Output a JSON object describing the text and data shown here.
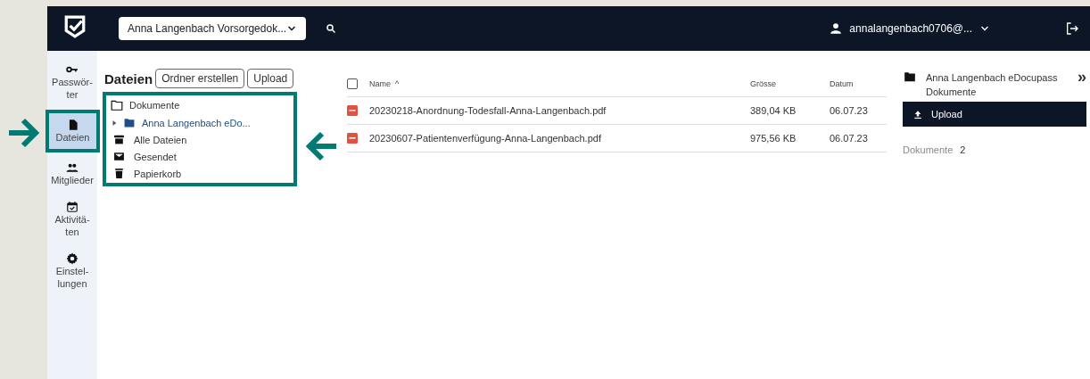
{
  "topbar": {
    "workspace": "Anna Langenbach Vorsorgedok...",
    "user": "annalangenbach0706@..."
  },
  "sidebar": {
    "items": [
      {
        "kind": "key",
        "lines": [
          "Passwör-",
          "ter"
        ],
        "selected": false
      },
      {
        "kind": "file",
        "lines": [
          "Dateien"
        ],
        "selected": true
      },
      {
        "kind": "users",
        "lines": [
          "Mitglieder"
        ],
        "selected": false
      },
      {
        "kind": "calendar",
        "lines": [
          "Aktivitä-",
          "ten"
        ],
        "selected": false
      },
      {
        "kind": "gear",
        "lines": [
          "Einstel-",
          "lungen"
        ],
        "selected": false
      }
    ]
  },
  "files_panel": {
    "title": "Dateien",
    "buttons": [
      "Ordner erstellen",
      "Upload"
    ],
    "tree": {
      "label": "Dokumente",
      "children": [
        {
          "label": "Anna Langenbach eDo...",
          "expanded": false
        }
      ]
    },
    "links": [
      {
        "kind": "archive",
        "label": "Alle Dateien"
      },
      {
        "kind": "mail",
        "label": "Gesendet"
      },
      {
        "kind": "trash",
        "label": "Papierkorb"
      }
    ]
  },
  "table": {
    "select_all": {
      "checked": false
    },
    "columns": [
      "Name",
      "Grösse",
      "Datum"
    ],
    "sort_indicator": "^",
    "rows": [
      {
        "name": "20230218-Anordnung-Todesfall-Anna-Langenbach.pdf",
        "size": "389,04 KB",
        "date": "06.07.23"
      },
      {
        "name": "20230607-Patientenverfügung-Anna-Langenbach.pdf",
        "size": "975,56 KB",
        "date": "06.07.23"
      }
    ]
  },
  "details": {
    "folder": "Anna Langenbach eDocupass Dokumente",
    "collapse": "»",
    "upload": "Upload",
    "count_label": "Dokumente",
    "count": "2"
  }
}
